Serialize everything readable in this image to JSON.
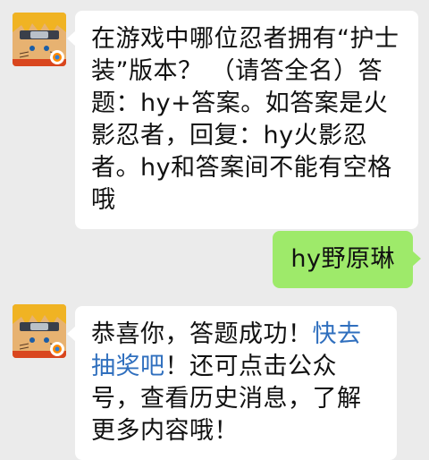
{
  "chat": {
    "messages": [
      {
        "sender": "official-account",
        "text": "在游戏中哪位忍者拥有“护士装”版本？ （请答全名）答题：hy+答案。如答案是火影忍者，回复：hy火影忍者。hy和答案间不能有空格哦"
      },
      {
        "sender": "user",
        "text": "hy野原琳"
      },
      {
        "sender": "official-account",
        "text_before_link": "恭喜你，答题成功！",
        "link_text": "快去抽奖吧",
        "text_after_link": "！还可点击公众号，查看历史消息，了解更多内容哦！"
      }
    ]
  },
  "colors": {
    "background": "#ebebeb",
    "incoming_bubble": "#ffffff",
    "outgoing_bubble": "#9eea6a",
    "link": "#2f6fbe"
  },
  "icons": {
    "avatar": "naruto-game-avatar-icon"
  }
}
